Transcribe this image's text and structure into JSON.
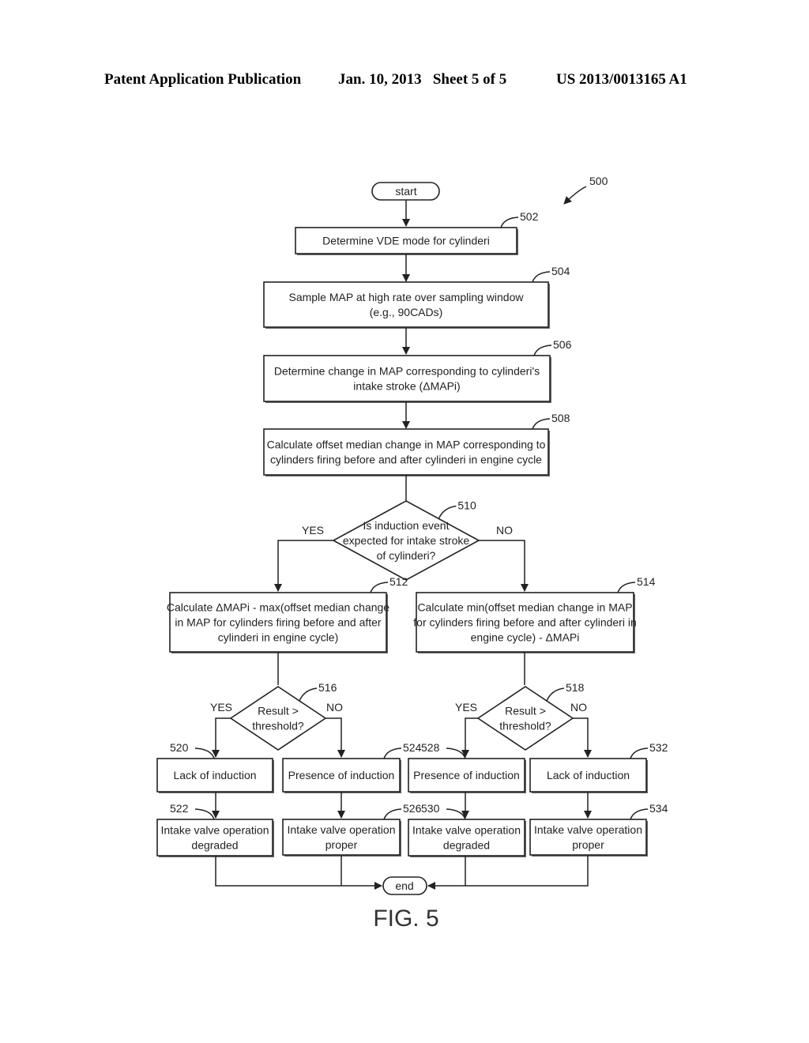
{
  "header": {
    "publication": "Patent Application Publication",
    "date_sheet": "Jan. 10, 2013   Sheet 5 of 5",
    "patent_number": "US 2013/0013165 A1"
  },
  "figure": {
    "label": "FIG. 5",
    "ref": "500"
  },
  "nodes": {
    "start": {
      "text": "start"
    },
    "end": {
      "text": "end"
    },
    "n502": {
      "ref": "502",
      "lines": [
        "Determine VDE mode for cylinderi"
      ]
    },
    "n504": {
      "ref": "504",
      "lines": [
        "Sample MAP at high rate over sampling window",
        "(e.g., 90CADs)"
      ]
    },
    "n506": {
      "ref": "506",
      "lines": [
        "Determine change in MAP corresponding to cylinderi's",
        "intake stroke (ΔMAPi)"
      ]
    },
    "n508": {
      "ref": "508",
      "lines": [
        "Calculate offset median change in MAP corresponding to",
        "cylinders firing before and after cylinderi in engine cycle"
      ]
    },
    "n510": {
      "ref": "510",
      "lines": [
        "Is induction event",
        "expected for intake stroke",
        "of cylinderi?"
      ],
      "yes": "YES",
      "no": "NO"
    },
    "n512": {
      "ref": "512",
      "lines": [
        "Calculate ΔMAPi - max(offset median change",
        "in MAP for cylinders firing before and after",
        "cylinderi in engine cycle)"
      ]
    },
    "n514": {
      "ref": "514",
      "lines": [
        "Calculate min(offset median change in MAP",
        "for cylinders firing before and after cylinderi in",
        "engine cycle) - ΔMAPi"
      ]
    },
    "n516": {
      "ref": "516",
      "lines": [
        "Result >",
        "threshold?"
      ],
      "yes": "YES",
      "no": "NO"
    },
    "n518": {
      "ref": "518",
      "lines": [
        "Result >",
        "threshold?"
      ],
      "yes": "YES",
      "no": "NO"
    },
    "n520": {
      "ref": "520",
      "lines": [
        "Lack of induction"
      ]
    },
    "n522": {
      "ref": "522",
      "lines": [
        "Intake valve operation",
        "degraded"
      ]
    },
    "n524": {
      "ref": "524",
      "lines": [
        "Presence of induction"
      ]
    },
    "n526": {
      "ref": "526",
      "lines": [
        "Intake valve operation",
        "proper"
      ]
    },
    "n528": {
      "ref": "528",
      "lines": [
        "Presence of induction"
      ]
    },
    "n530": {
      "ref": "530",
      "lines": [
        "Intake valve operation",
        "degraded"
      ]
    },
    "n532": {
      "ref": "532",
      "lines": [
        "Lack of induction"
      ]
    },
    "n534": {
      "ref": "534",
      "lines": [
        "Intake valve operation",
        "proper"
      ]
    }
  }
}
